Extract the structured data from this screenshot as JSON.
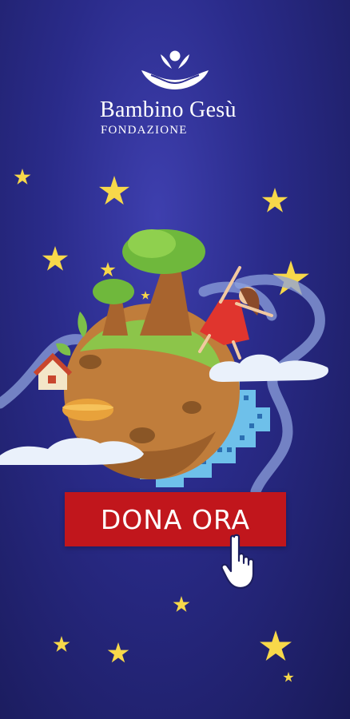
{
  "brand": {
    "name": "Bambino Gesù",
    "subtitle": "FONDAZIONE",
    "logo_icon": "hands-holding-child-icon"
  },
  "cta": {
    "label": "DONA ORA",
    "color": "#c1161c",
    "pointer_icon": "hand-pointer-icon"
  },
  "illustration": {
    "name": "planet-with-trees-child-and-city",
    "decorations": [
      "stars",
      "clouds",
      "swirling-wind"
    ]
  },
  "colors": {
    "background": "#2a2b8a",
    "star": "#f7d84a",
    "text": "#ffffff"
  }
}
